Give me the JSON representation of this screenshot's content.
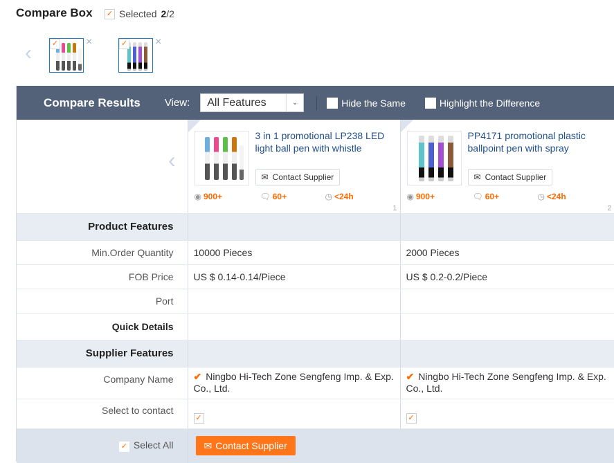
{
  "compare_box": {
    "title": "Compare Box",
    "selected_label": "Selected",
    "selected_count": "2",
    "selected_total": "/2",
    "thumbnails": [
      {
        "name": "3 in 1 promotional LP238 LED light ball pen with whistle",
        "checked": true
      },
      {
        "name": "PP4171 promotional plastic ballpoint pen with spray",
        "checked": true
      }
    ],
    "remove_icon": "×",
    "prev_icon": "‹"
  },
  "results": {
    "title": "Compare Results",
    "view_label": "View:",
    "view_selected": "All Features",
    "hide_same": "Hide the Same",
    "highlight_diff": "Highlight the Difference"
  },
  "products": [
    {
      "name": "3 in 1 promotional LP238 LED light ball pen with whistle",
      "contact_label": "Contact Supplier",
      "views": "900+",
      "messages": "60+",
      "response": "<24h",
      "index": "1",
      "min_order": "10000 Pieces",
      "fob_price": "US $ 0.14-0.14/Piece",
      "port": "",
      "company": "Ningbo Hi-Tech Zone Sengfeng Imp. & Exp. Co., Ltd.",
      "selected": true
    },
    {
      "name": "PP4171 promotional plastic ballpoint pen with spray",
      "contact_label": "Contact Supplier",
      "views": "900+",
      "messages": "60+",
      "response": "<24h",
      "index": "2",
      "min_order": "2000 Pieces",
      "fob_price": "US $ 0.2-0.2/Piece",
      "port": "",
      "company": "Ningbo Hi-Tech Zone Sengfeng Imp. & Exp. Co., Ltd.",
      "selected": true
    }
  ],
  "rows": {
    "product_features": "Product Features",
    "min_order": "Min.Order Quantity",
    "fob_price": "FOB Price",
    "port": "Port",
    "quick_details": "Quick Details",
    "supplier_features": "Supplier Features",
    "company_name": "Company Name",
    "select_to_contact": "Select to contact"
  },
  "footer": {
    "select_all": "Select All",
    "contact_button": "Contact Supplier"
  },
  "colors": {
    "accent": "#ff6a00",
    "header_bar": "#536278",
    "link": "#1f4e8c",
    "section_bg": "#e8edf4"
  }
}
